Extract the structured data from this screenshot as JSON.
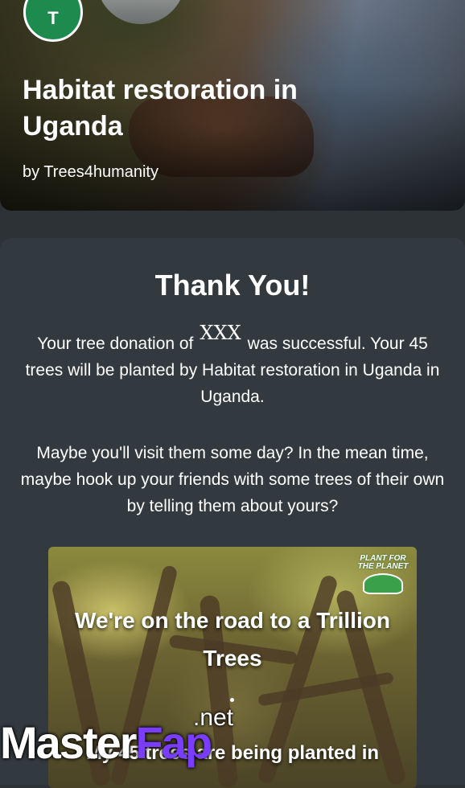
{
  "hero": {
    "avatar_initial": "T",
    "title": "Habitat restoration in Uganda",
    "byline": "by Trees4humanity"
  },
  "card": {
    "heading": "Thank You!",
    "donation_text_before": "Your tree donation of",
    "donation_amount": "XXX",
    "donation_text_after": "was successful. Your 45 trees will be planted by Habitat restoration in Uganda in Uganda.",
    "follow_up": "Maybe you'll visit them some day? In the mean time, maybe hook up your friends with some trees of their own by telling them about yours?"
  },
  "banner": {
    "logo_text": "PLANT FOR THE PLANET",
    "title": "We're on the road to a Trillion Trees",
    "subtitle": "My 45 trees are being planted in"
  },
  "watermark": {
    "net": ".net",
    "part1": "Master",
    "part2": "Fap"
  }
}
